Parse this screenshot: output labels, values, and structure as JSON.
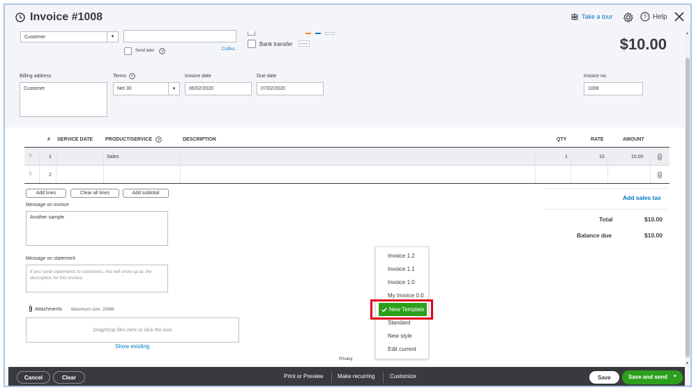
{
  "header": {
    "title": "Invoice #1008",
    "take_tour": "Take a tour",
    "help": "Help"
  },
  "form": {
    "customer_value": "Customer",
    "send_later": "Send later",
    "cc_bcc": "Cc/Bcc",
    "bank_transfer": "Bank transfer",
    "bank_badge": "BANK",
    "balance": "$10.00",
    "billing_address_label": "Billing address",
    "billing_address_value": "Customer",
    "terms_label": "Terms",
    "terms_value": "Net 30",
    "invoice_date_label": "Invoice date",
    "invoice_date_value": "06/02/2020",
    "due_date_label": "Due date",
    "due_date_value": "07/02/2020",
    "invoice_no_label": "Invoice no.",
    "invoice_no_value": "1008"
  },
  "table": {
    "headers": {
      "num": "#",
      "service_date": "SERVICE DATE",
      "product": "PRODUCT/SERVICE",
      "description": "DESCRIPTION",
      "qty": "QTY",
      "rate": "RATE",
      "amount": "AMOUNT"
    },
    "rows": [
      {
        "num": "1",
        "product": "Sales",
        "qty": "1",
        "rate": "10",
        "amount": "10.00"
      },
      {
        "num": "2",
        "product": "",
        "qty": "",
        "rate": "",
        "amount": ""
      }
    ]
  },
  "actions": {
    "add_lines": "Add lines",
    "clear_all_lines": "Clear all lines",
    "add_subtotal": "Add subtotal"
  },
  "message_invoice": {
    "label": "Message on invoice",
    "value": "Another sample"
  },
  "message_statement": {
    "label": "Message on statement",
    "placeholder": "If you send statements to customers, this will show up as the description for this invoice."
  },
  "attachments": {
    "label": "Attachments",
    "max_size": "Maximum size: 20MB",
    "drop_text": "Drag/Drop files here or click the icon",
    "show_existing": "Show existing"
  },
  "totals": {
    "add_sales_tax": "Add sales tax",
    "total_label": "Total",
    "total_value": "$10.00",
    "balance_due_label": "Balance due",
    "balance_due_value": "$10.00"
  },
  "privacy": "Privacy",
  "customize_menu": {
    "items": [
      "Invoice 1.2",
      "Invoice 1.1",
      "Invoice 1.0",
      "My Invoice 0.0",
      "New Template",
      "Standard",
      "New style",
      "Edit current"
    ],
    "selected": "New Template"
  },
  "footer": {
    "cancel": "Cancel",
    "clear": "Clear",
    "print_preview": "Print or Preview",
    "make_recurring": "Make recurring",
    "customize": "Customize",
    "save": "Save",
    "save_and_send": "Save and send"
  },
  "colors": {
    "accent_green": "#2ca01c",
    "link_blue": "#0077c5",
    "footer_dark": "#393a3d",
    "highlight_red": "#e0001b"
  }
}
